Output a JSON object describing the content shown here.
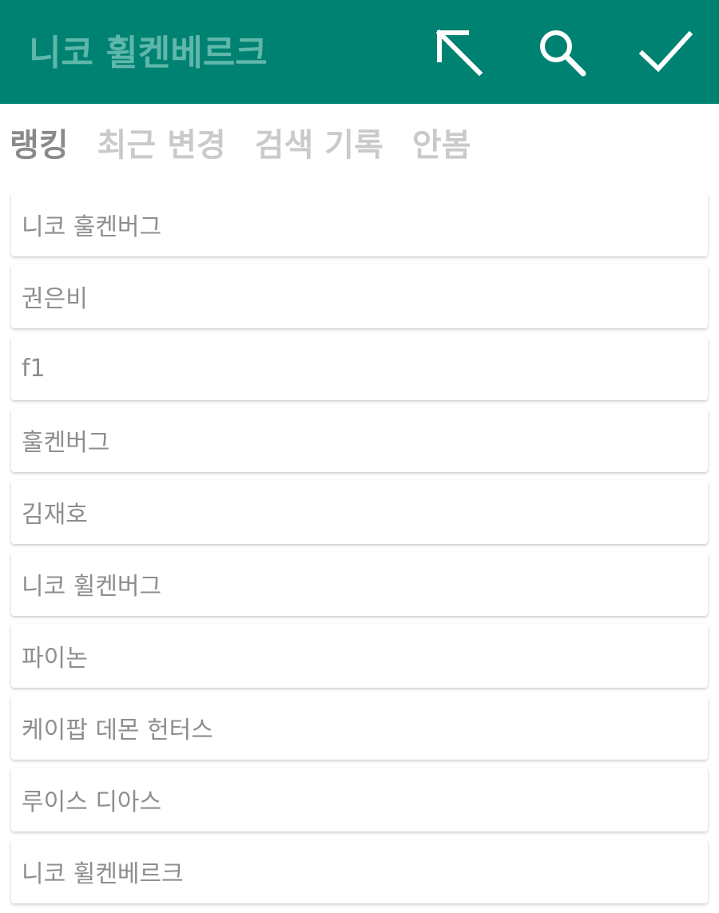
{
  "appbar": {
    "search_placeholder": "니코 휠켄베르크",
    "search_value": "",
    "background_color": "#008272",
    "icons": {
      "back": "arrow-up-left-icon",
      "search": "search-icon",
      "confirm": "checkmark-icon"
    }
  },
  "tabs": [
    {
      "label": "랭킹",
      "active": true
    },
    {
      "label": "최근 변경",
      "active": false
    },
    {
      "label": "검색 기록",
      "active": false
    },
    {
      "label": "안봄",
      "active": false
    }
  ],
  "results": [
    {
      "label": "니코 훌켄버그"
    },
    {
      "label": "권은비"
    },
    {
      "label": "f1"
    },
    {
      "label": "훌켄버그"
    },
    {
      "label": "김재호"
    },
    {
      "label": "니코 휠켄버그"
    },
    {
      "label": "파이논"
    },
    {
      "label": "케이팝 데몬 헌터스"
    },
    {
      "label": "루이스 디아스"
    },
    {
      "label": "니코 휠켄베르크"
    }
  ]
}
